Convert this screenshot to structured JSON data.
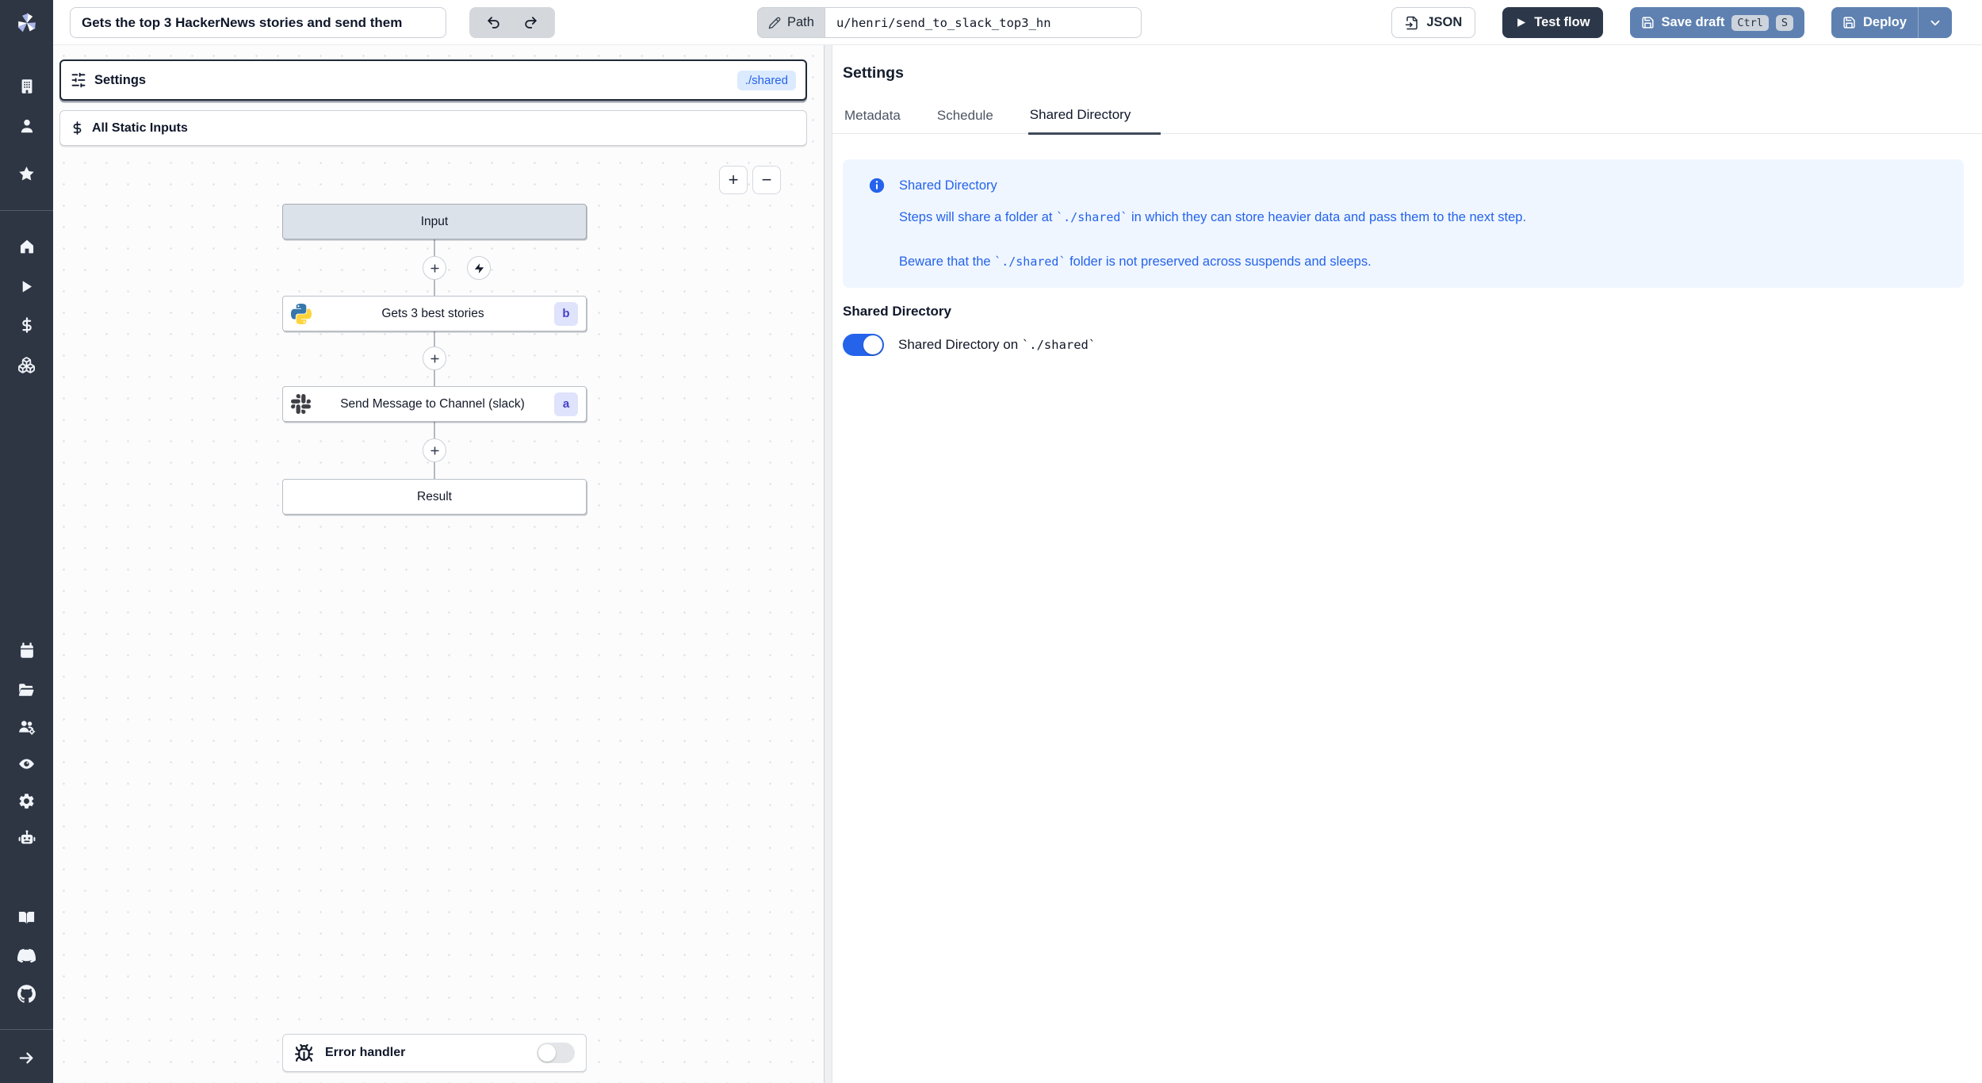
{
  "topbar": {
    "title_value": "Gets the top 3 HackerNews stories and send them",
    "path_label": "Path",
    "path_value": "u/henri/send_to_slack_top3_hn",
    "json_button": "JSON",
    "test_flow_button": "Test flow",
    "save_draft_button": "Save draft",
    "save_kbd": [
      "Ctrl",
      "S"
    ],
    "deploy_button": "Deploy"
  },
  "sidebar": {
    "icons": [
      "windmill-logo",
      "building-icon",
      "user-icon",
      "star-icon",
      "home-icon",
      "play-icon",
      "dollar-icon",
      "boxes-icon",
      "calendar-icon",
      "folder-open-icon",
      "users-gear-icon",
      "eye-icon",
      "gear-icon",
      "robot-icon",
      "book-icon",
      "discord-icon",
      "github-icon",
      "arrow-right-icon"
    ]
  },
  "flow": {
    "settings_label": "Settings",
    "shared_badge": "./shared",
    "static_inputs_label": "All Static Inputs",
    "zoom_in": "+",
    "zoom_out": "−",
    "nodes": {
      "input_label": "Input",
      "step1": {
        "label": "Gets 3 best stories",
        "badge": "b",
        "icon": "python-icon"
      },
      "step2": {
        "label": "Send Message to Channel (slack)",
        "badge": "a",
        "icon": "slack-icon"
      },
      "result_label": "Result",
      "error_handler_label": "Error handler"
    }
  },
  "panel": {
    "title": "Settings",
    "tabs": [
      {
        "label": "Metadata",
        "active": false
      },
      {
        "label": "Schedule",
        "active": false
      },
      {
        "label": "Shared Directory",
        "active": true
      }
    ],
    "info": {
      "title": "Shared Directory",
      "p1_pre": "Steps will share a folder at ",
      "p1_code": "`./shared`",
      "p1_post": " in which they can store heavier data and pass them to the next step.",
      "p2_pre": "Beware that the ",
      "p2_code": "`./shared`",
      "p2_post": " folder is not preserved across suspends and sleeps."
    },
    "section_title": "Shared Directory",
    "toggle": {
      "state": "on",
      "label_pre": "Shared Directory on ",
      "label_code": "`./shared`"
    }
  },
  "colors": {
    "sidebar_bg": "#2e3644",
    "accent_blue": "#2563eb",
    "button_blue": "#5e81b1",
    "button_dark": "#2c3849",
    "badge_indigo_bg": "#dfe3fc",
    "badge_indigo_text": "#4640c8",
    "info_bg": "#eff6ff",
    "shared_badge_bg": "#dbeafe"
  }
}
